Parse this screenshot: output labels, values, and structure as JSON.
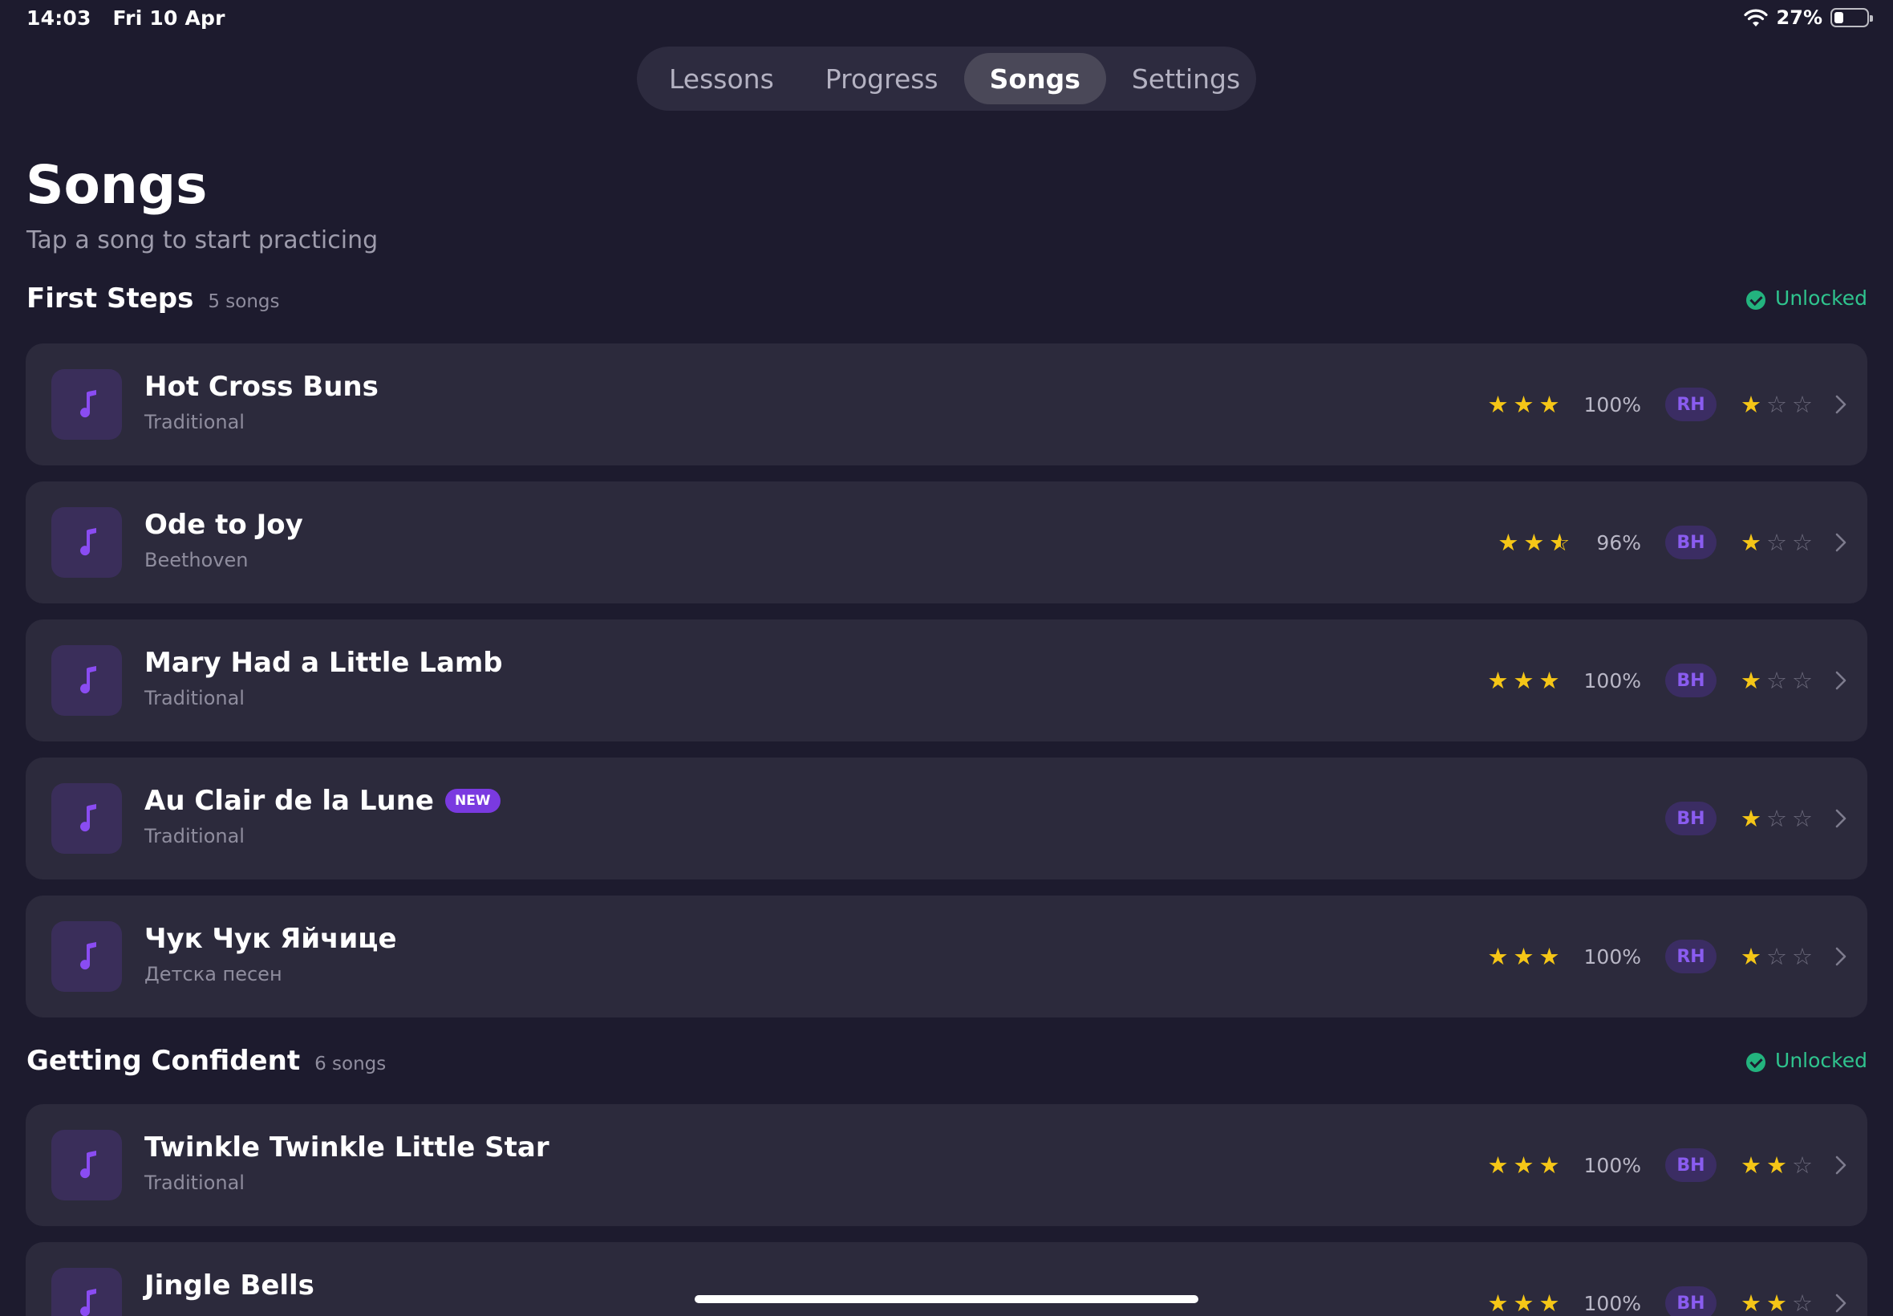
{
  "status_bar": {
    "time": "14:03",
    "date": "Fri 10 Apr",
    "battery": "27%",
    "battery_level": 0.27
  },
  "tabs": [
    {
      "label": "Lessons",
      "active": false
    },
    {
      "label": "Progress",
      "active": false
    },
    {
      "label": "Songs",
      "active": true
    },
    {
      "label": "Settings",
      "active": false
    }
  ],
  "page": {
    "title": "Songs",
    "subtitle": "Tap a song to start practicing"
  },
  "sections": [
    {
      "title": "First Steps",
      "count": "5 songs",
      "status": "Unlocked",
      "songs": [
        {
          "title": "Hot Cross Buns",
          "artist": "Traditional",
          "is_new": false,
          "score_stars": 3,
          "score": "100%",
          "hand": "RH",
          "difficulty": 1
        },
        {
          "title": "Ode to Joy",
          "artist": "Beethoven",
          "is_new": false,
          "score_stars": 2.5,
          "score": "96%",
          "hand": "BH",
          "difficulty": 1
        },
        {
          "title": "Mary Had a Little Lamb",
          "artist": "Traditional",
          "is_new": false,
          "score_stars": 3,
          "score": "100%",
          "hand": "BH",
          "difficulty": 1
        },
        {
          "title": "Au Clair de la Lune",
          "artist": "Traditional",
          "is_new": true,
          "new_label": "NEW",
          "score_stars": null,
          "score": "",
          "hand": "BH",
          "difficulty": 1
        },
        {
          "title": "Чук Чук Яйчице",
          "artist": "Детска песен",
          "is_new": false,
          "score_stars": 3,
          "score": "100%",
          "hand": "RH",
          "difficulty": 1
        }
      ]
    },
    {
      "title": "Getting Confident",
      "count": "6 songs",
      "status": "Unlocked",
      "songs": [
        {
          "title": "Twinkle Twinkle Little Star",
          "artist": "Traditional",
          "is_new": false,
          "score_stars": 3,
          "score": "100%",
          "hand": "BH",
          "difficulty": 2
        },
        {
          "title": "Jingle Bells",
          "artist": "",
          "is_new": false,
          "score_stars": 3,
          "score": "100%",
          "hand": "BH",
          "difficulty": 2
        }
      ]
    }
  ],
  "colors": {
    "background": "#1d1b2e",
    "card": "#2c2a3c",
    "accent": "#8a5cf0",
    "star": "#f5c617",
    "unlocked": "#2fc48e"
  },
  "icons": {
    "song": "music-note-icon",
    "unlocked": "check-circle-icon",
    "row_action": "chevron-right-icon",
    "wifi": "wifi-icon",
    "battery": "battery-icon"
  }
}
